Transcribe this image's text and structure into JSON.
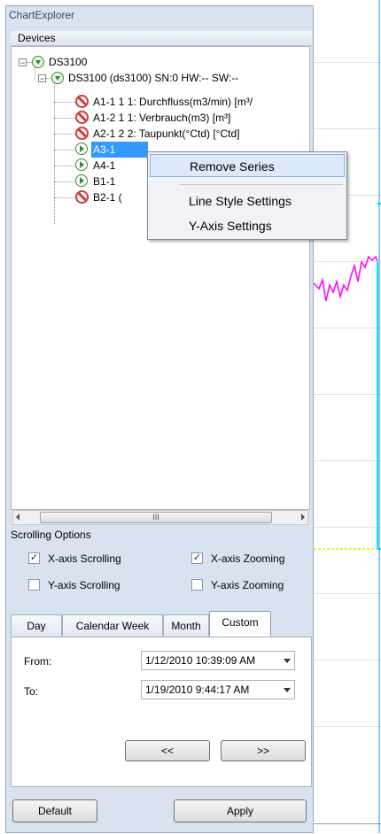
{
  "panel": {
    "title": "ChartExplorer"
  },
  "devices": {
    "header": "Devices",
    "root": "DS3100",
    "device": "DS3100 (ds3100)  SN:0  HW:--  SW:--",
    "items": [
      {
        "label": "A1-1 1 1: Durchfluss(m3/min) [m³/",
        "state": "disabled"
      },
      {
        "label": "A1-2 1 1: Verbrauch(m3) [m³]",
        "state": "disabled"
      },
      {
        "label": "A2-1 2 2: Taupunkt(°Ctd) [°Ctd]",
        "state": "disabled"
      },
      {
        "label": "A3-1",
        "state": "active",
        "selected": true
      },
      {
        "label": "A4-1",
        "state": "active"
      },
      {
        "label": "B1-1",
        "state": "active"
      },
      {
        "label": "B2-1 (",
        "state": "disabled"
      }
    ]
  },
  "scrollbar": {
    "thumb_glyph": "III"
  },
  "context_menu": {
    "items": [
      "Remove Series",
      "Line Style Settings",
      "Y-Axis Settings"
    ],
    "highlighted": "Remove Series"
  },
  "scrolling": {
    "title": "Scrolling Options",
    "x_scroll": {
      "label": "X-axis Scrolling",
      "checked": true
    },
    "x_zoom": {
      "label": "X-axis Zooming",
      "checked": true
    },
    "y_scroll": {
      "label": "Y-axis Scrolling",
      "checked": false
    },
    "y_zoom": {
      "label": "Y-axis Zooming",
      "checked": false
    }
  },
  "tabs": {
    "items": [
      "Day",
      "Calendar Week",
      "Month",
      "Custom"
    ],
    "active": "Custom"
  },
  "range": {
    "from_label": "From:",
    "from_value": "1/12/2010 10:39:09 AM",
    "to_label": "To:",
    "to_value": "1/19/2010 9:44:17 AM",
    "prev_label": "<<",
    "next_label": ">>"
  },
  "footer": {
    "default_label": "Default",
    "apply_label": "Apply"
  },
  "colors": {
    "series_magenta": "#ff00ff",
    "series_cyan": "#00e5ff",
    "series_yellow": "#e8e800",
    "selection": "#3399ff"
  }
}
